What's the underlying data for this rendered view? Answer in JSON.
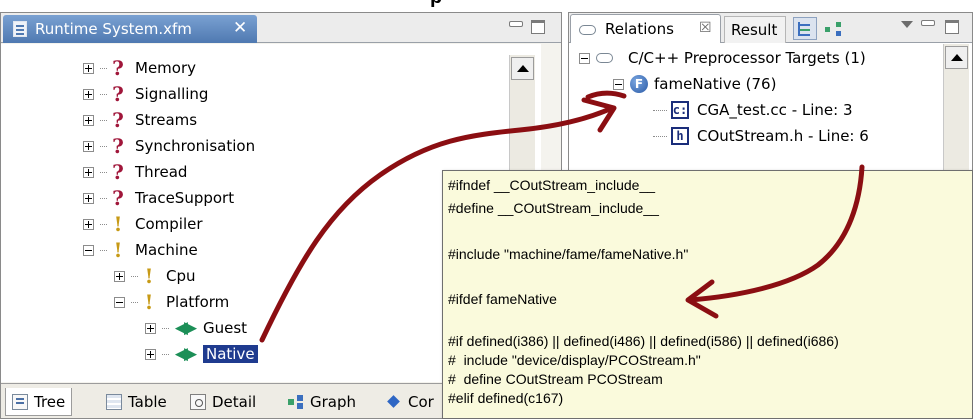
{
  "top_fragment": "p",
  "left_editor": {
    "tab_title": "Runtime System.xfm",
    "tab_close": "✕",
    "tree_items": [
      {
        "label": "Memory",
        "icon": "question-icon"
      },
      {
        "label": "Signalling",
        "icon": "question-icon"
      },
      {
        "label": "Streams",
        "icon": "question-icon"
      },
      {
        "label": "Synchronisation",
        "icon": "question-icon"
      },
      {
        "label": "Thread",
        "icon": "question-icon"
      },
      {
        "label": "TraceSupport",
        "icon": "question-icon"
      },
      {
        "label": "Compiler",
        "icon": "exclamation-icon"
      },
      {
        "label": "Machine",
        "icon": "exclamation-icon"
      },
      {
        "label": "Cpu",
        "icon": "exclamation-icon"
      },
      {
        "label": "Platform",
        "icon": "exclamation-icon"
      },
      {
        "label": "Guest",
        "icon": "diamond-arrows-icon"
      },
      {
        "label": "Native",
        "icon": "diamond-arrows-icon",
        "selected": true
      }
    ],
    "bottom_tabs": [
      {
        "label": "Tree",
        "icon": "tree-icon",
        "active": true
      },
      {
        "label": "Table",
        "icon": "table-icon"
      },
      {
        "label": "Detail",
        "icon": "detail-icon"
      },
      {
        "label": "Graph",
        "icon": "graph-icon"
      },
      {
        "label": "Cor",
        "icon": "diamond-icon"
      }
    ]
  },
  "relations_view": {
    "tab_relations": "Relations",
    "tab_relations_close": "☒",
    "tab_result": "Result",
    "tree": [
      {
        "label": "C/C++ Preprocessor Targets (1)",
        "icon": "link-icon"
      },
      {
        "label": "fameNative (76)",
        "icon": "f-icon",
        "icon_text": "F"
      },
      {
        "label": "CGA_test.cc - Line: 3",
        "icon": "cpp-file-icon",
        "icon_text": "c:"
      },
      {
        "label": "COutStream.h - Line: 6",
        "icon": "header-file-icon",
        "icon_text": "h"
      }
    ]
  },
  "code_popup": {
    "lines": [
      "#ifndef __COutStream_include__",
      "#define __COutStream_include__",
      "",
      "#include \"machine/fame/fameNative.h\"",
      "",
      "#ifdef fameNative",
      "",
      "#if defined(i386) || defined(i486) || defined(i586) || defined(i686)",
      "#  include \"device/display/PCOStream.h\"",
      "#  define COutStream PCOStream",
      "#elif defined(c167)"
    ]
  },
  "colors": {
    "selection": "#1f3b8f",
    "arrow": "#8b0e12",
    "popup_background": "#fafadc",
    "tab_active": "#5a84bd"
  }
}
